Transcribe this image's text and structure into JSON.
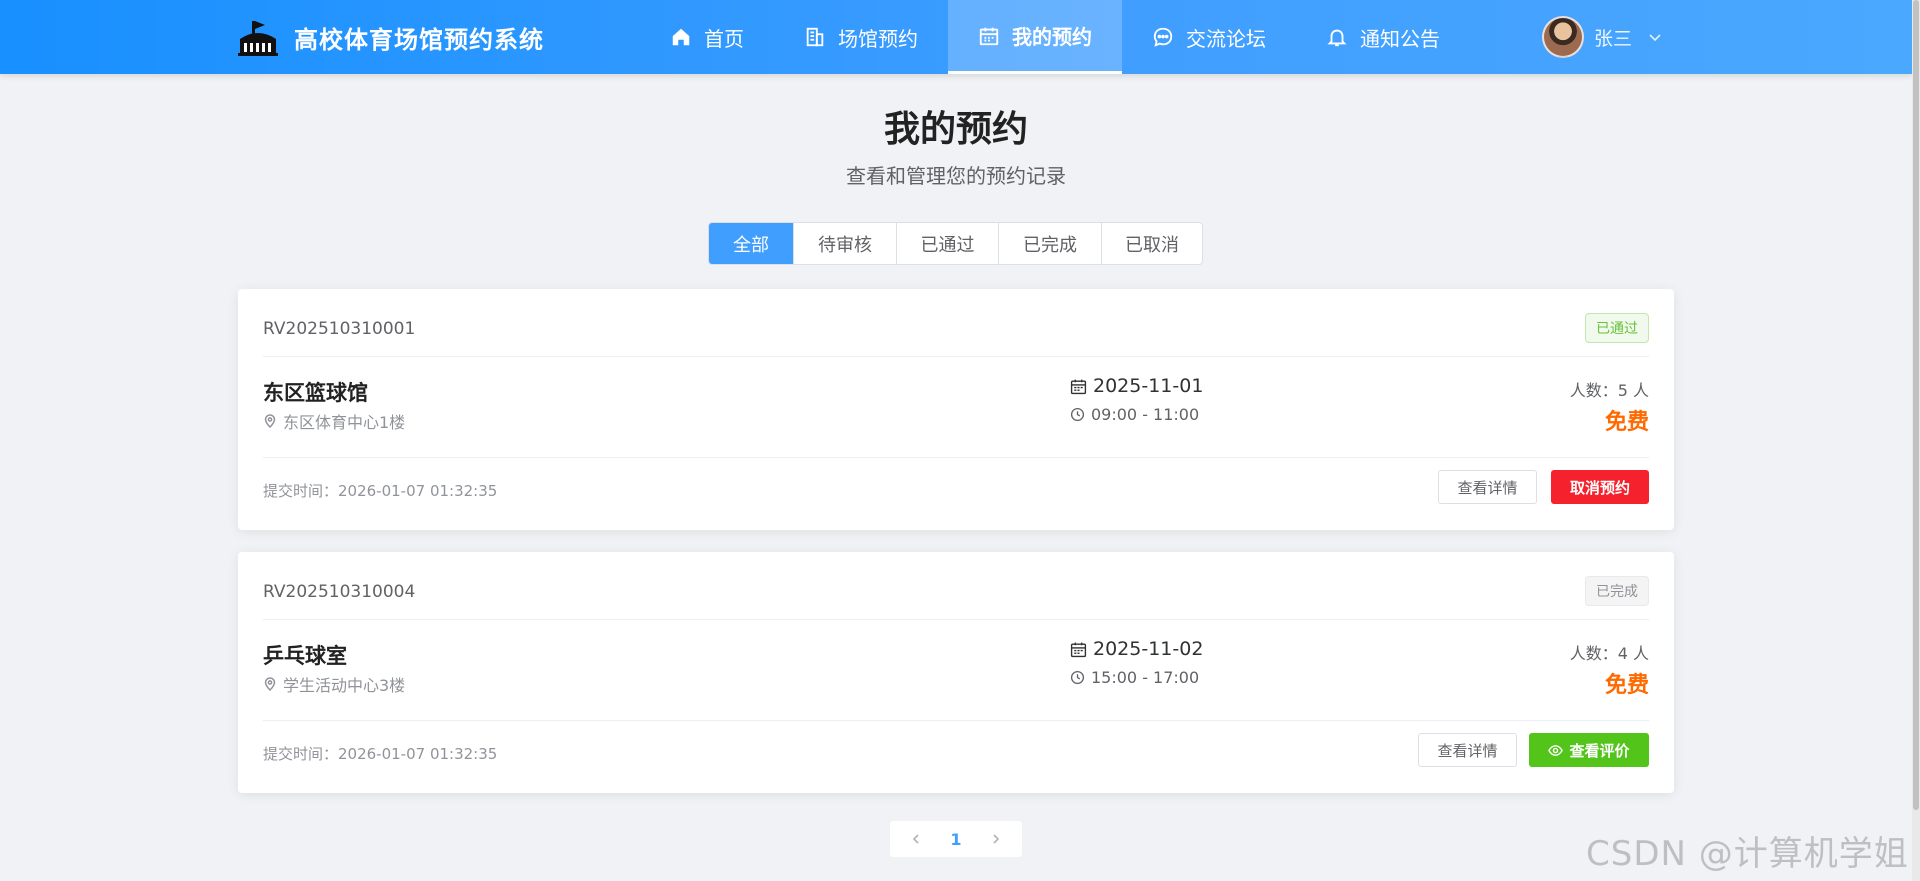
{
  "app": {
    "title": "高校体育场馆预约系统",
    "accent": "#409eff",
    "nav": [
      {
        "label": "首页",
        "icon": "home-icon",
        "active": false
      },
      {
        "label": "场馆预约",
        "icon": "building-icon",
        "active": false
      },
      {
        "label": "我的预约",
        "icon": "calendar-icon",
        "active": true
      },
      {
        "label": "交流论坛",
        "icon": "chat-icon",
        "active": false
      },
      {
        "label": "通知公告",
        "icon": "bell-icon",
        "active": false
      }
    ],
    "user": {
      "name": "张三"
    }
  },
  "page": {
    "title": "我的预约",
    "subtitle": "查看和管理您的预约记录"
  },
  "filters": {
    "tabs": [
      "全部",
      "待审核",
      "已通过",
      "已完成",
      "已取消"
    ],
    "active": "全部"
  },
  "reservations": [
    {
      "no": "RV202510310001",
      "status": "已通过",
      "status_color": "#67c23a",
      "venue": "东区篮球馆",
      "address": "东区体育中心1楼",
      "date": "2025-11-01",
      "time": "09:00 - 11:00",
      "people": "人数：5 人",
      "price": "免费",
      "submitted": "提交时间：2026-01-07 01:32:35",
      "actions": {
        "detail": "查看详情",
        "primary": "取消预约"
      }
    },
    {
      "no": "RV202510310004",
      "status": "已完成",
      "status_color": "#909399",
      "venue": "乒乓球室",
      "address": "学生活动中心3楼",
      "date": "2025-11-02",
      "time": "15:00 - 17:00",
      "people": "人数：4 人",
      "price": "免费",
      "submitted": "提交时间：2026-01-07 01:32:35",
      "actions": {
        "detail": "查看详情",
        "primary": "查看评价"
      }
    }
  ],
  "pagination": {
    "current": "1"
  },
  "watermark": "CSDN @计算机学姐"
}
